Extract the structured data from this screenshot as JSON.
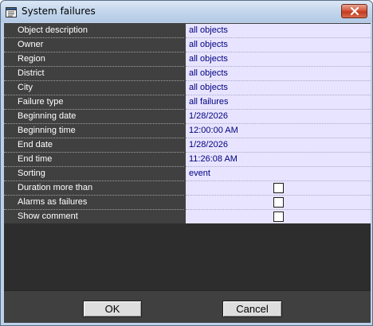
{
  "window": {
    "title": "System failures",
    "title_icon": "window-list-icon",
    "close_icon": "close-icon"
  },
  "rows": [
    {
      "label": "Object description",
      "value": "all objects"
    },
    {
      "label": "Owner",
      "value": "all objects"
    },
    {
      "label": "Region",
      "value": "all objects"
    },
    {
      "label": "District",
      "value": "all objects"
    },
    {
      "label": "City",
      "value": "all objects"
    },
    {
      "label": "Failure type",
      "value": "all failures"
    },
    {
      "label": "Beginning date",
      "value": "1/28/2026"
    },
    {
      "label": "Beginning time",
      "value": "12:00:00 AM"
    },
    {
      "label": "End date",
      "value": "1/28/2026"
    },
    {
      "label": "End time",
      "value": "11:26:08 AM"
    },
    {
      "label": "Sorting",
      "value": "event"
    }
  ],
  "checks": [
    {
      "label": "Duration more than",
      "checked": false
    },
    {
      "label": "Alarms as failures",
      "checked": false
    },
    {
      "label": "Show comment",
      "checked": false
    }
  ],
  "buttons": {
    "ok": "OK",
    "cancel": "Cancel"
  },
  "colors": {
    "label_bg": "#404040",
    "value_bg": "#e8e4ff",
    "value_text": "#000080",
    "close_button": "#c23a1e"
  }
}
